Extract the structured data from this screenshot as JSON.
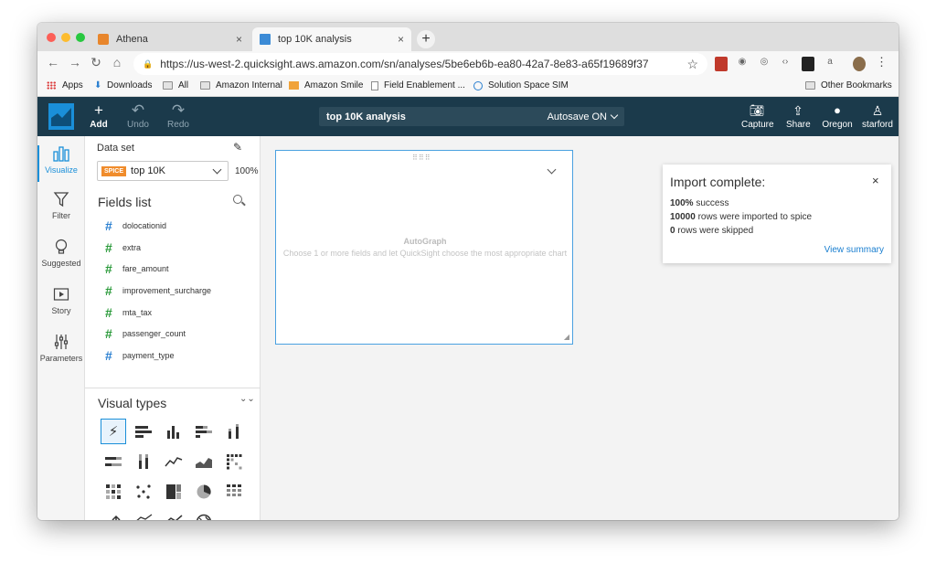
{
  "browser": {
    "tabs": [
      {
        "label": "Athena",
        "close": "×"
      },
      {
        "label": "top 10K analysis",
        "close": "×"
      }
    ],
    "new_tab": "+",
    "nav": {
      "back": "←",
      "forward": "→",
      "reload": "↻",
      "home": "⌂"
    },
    "url": "https://us-west-2.quicksight.aws.amazon.com/sn/analyses/5be6eb6b-ea80-42a7-8e83-a65f19689f37",
    "star": "☆",
    "menu": "⋮",
    "bookmarks": [
      {
        "label": "Apps"
      },
      {
        "label": "Downloads"
      },
      {
        "label": "All"
      },
      {
        "label": "Amazon Internal"
      },
      {
        "label": "Amazon Smile"
      },
      {
        "label": "Field Enablement ..."
      },
      {
        "label": "Solution Space SIM"
      }
    ],
    "other_bookmarks": "Other Bookmarks"
  },
  "header": {
    "add": "Add",
    "undo": "Undo",
    "redo": "Redo",
    "analysis_title": "top 10K analysis",
    "autosave": "Autosave ON",
    "capture": "Capture",
    "share": "Share",
    "region": "Oregon",
    "user": "starford",
    "colors": {
      "bg": "#1b3a4b",
      "accent": "#1a8fd9"
    }
  },
  "leftnav": [
    {
      "label": "Visualize",
      "icon": "bar-chart-icon"
    },
    {
      "label": "Filter",
      "icon": "funnel-icon"
    },
    {
      "label": "Suggested",
      "icon": "lightbulb-icon"
    },
    {
      "label": "Story",
      "icon": "play-icon"
    },
    {
      "label": "Parameters",
      "icon": "sliders-icon"
    }
  ],
  "dataset": {
    "label": "Data set",
    "badge": "SPICE",
    "name": "top 10K",
    "percent": "100%"
  },
  "fields": {
    "heading": "Fields list",
    "items": [
      "dolocationid",
      "extra",
      "fare_amount",
      "improvement_surcharge",
      "mta_tax",
      "passenger_count",
      "payment_type"
    ]
  },
  "visual_types": {
    "heading": "Visual types",
    "items": [
      "autograph",
      "horizontal-bar",
      "vertical-bar",
      "horizontal-stacked-bar",
      "vertical-stacked-bar",
      "horizontal-100-bar",
      "vertical-100-bar",
      "line",
      "area-line",
      "pivot-table",
      "heat-map",
      "scatter",
      "tree-map",
      "pie",
      "table",
      "kpi",
      "combo-bar",
      "combo-line",
      "geo"
    ],
    "selected": "autograph"
  },
  "visual": {
    "title": "AutoGraph",
    "subtitle": "Choose 1 or more fields and let QuickSight choose the most appropriate chart"
  },
  "toast": {
    "title": "Import complete:",
    "close": "×",
    "success_pct": "100%",
    "success_text": " success",
    "rows_imported": "10000",
    "rows_imported_text": " rows were imported to spice",
    "rows_skipped": "0",
    "rows_skipped_text": " rows were skipped",
    "link": "View summary"
  }
}
